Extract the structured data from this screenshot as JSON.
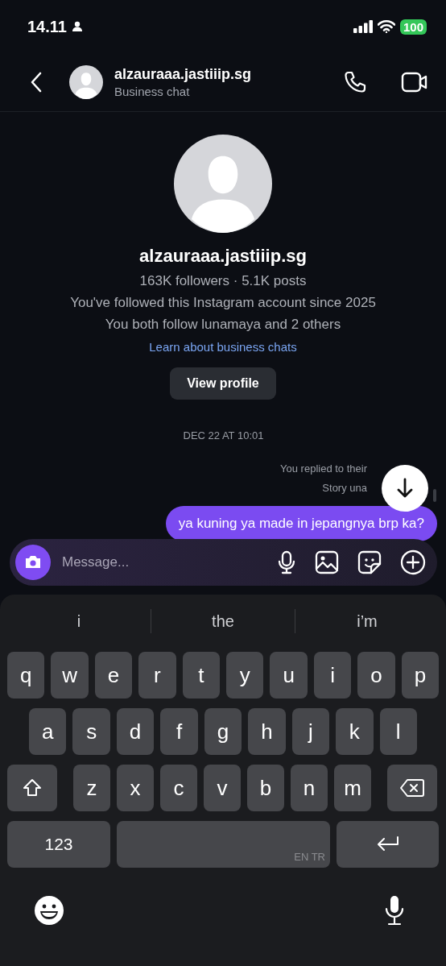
{
  "status_bar": {
    "time": "14.11",
    "battery": "100"
  },
  "header": {
    "name": "alzauraaa.jastiiip.sg",
    "subtitle": "Business chat"
  },
  "profile": {
    "name": "alzauraaa.jastiiip.sg",
    "stats": "163K followers · 5.1K posts",
    "followed_since": "You've followed this Instagram account since 2025",
    "mutual": "You both follow lunamaya and 2 others",
    "link": "Learn about business chats",
    "button": "View profile"
  },
  "messages": [
    {
      "kind": "timestamp",
      "text": "DEC 22 AT 10:01"
    },
    {
      "kind": "note",
      "text": "You replied to their"
    },
    {
      "kind": "note",
      "text": "Story una"
    },
    {
      "kind": "sent",
      "text": "ya kuning ya made in jepangnya brp ka?"
    }
  ],
  "composer": {
    "placeholder": "Message..."
  },
  "keyboard": {
    "suggestions": [
      "i",
      "the",
      "i’m"
    ],
    "rows": [
      {
        "keys": [
          {
            "kind": "char",
            "label": "q"
          },
          {
            "kind": "char",
            "label": "w"
          },
          {
            "kind": "char",
            "label": "e"
          },
          {
            "kind": "char",
            "label": "r"
          },
          {
            "kind": "char",
            "label": "t"
          },
          {
            "kind": "char",
            "label": "y"
          },
          {
            "kind": "char",
            "label": "u"
          },
          {
            "kind": "char",
            "label": "i"
          },
          {
            "kind": "char",
            "label": "o"
          },
          {
            "kind": "char",
            "label": "p"
          }
        ]
      },
      {
        "keys": [
          {
            "kind": "char",
            "label": "a"
          },
          {
            "kind": "char",
            "label": "s"
          },
          {
            "kind": "char",
            "label": "d"
          },
          {
            "kind": "char",
            "label": "f"
          },
          {
            "kind": "char",
            "label": "g"
          },
          {
            "kind": "char",
            "label": "h"
          },
          {
            "kind": "char",
            "label": "j"
          },
          {
            "kind": "char",
            "label": "k"
          },
          {
            "kind": "char",
            "label": "l"
          }
        ]
      },
      {
        "keys": [
          {
            "kind": "shift"
          },
          {
            "kind": "char",
            "label": "z"
          },
          {
            "kind": "char",
            "label": "x"
          },
          {
            "kind": "char",
            "label": "c"
          },
          {
            "kind": "char",
            "label": "v"
          },
          {
            "kind": "char",
            "label": "b"
          },
          {
            "kind": "char",
            "label": "n"
          },
          {
            "kind": "char",
            "label": "m"
          },
          {
            "kind": "delete"
          }
        ]
      },
      {
        "keys": [
          {
            "kind": "numbers",
            "label": "123"
          },
          {
            "kind": "space",
            "label": "EN TR"
          },
          {
            "kind": "return"
          }
        ]
      }
    ]
  }
}
